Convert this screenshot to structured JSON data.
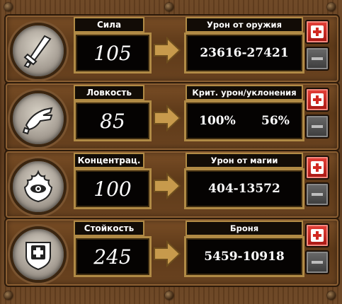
{
  "rows": [
    {
      "icon": "sword-icon",
      "stat_label": "Сила",
      "stat_value": "105",
      "result_label": "Урон от оружия",
      "result_value": "23616-27421",
      "plus_label": "+",
      "minus_label": "−"
    },
    {
      "icon": "dodge-hand-icon",
      "stat_label": "Ловкость",
      "stat_value": "85",
      "result_label": "Крит. урон/уклонения",
      "result_crit": "100%",
      "result_dodge": "56%",
      "plus_label": "+",
      "minus_label": "−"
    },
    {
      "icon": "fire-eye-icon",
      "stat_label": "Концентрац.",
      "stat_value": "100",
      "result_label": "Урон от магии",
      "result_value": "404-13572",
      "plus_label": "+",
      "minus_label": "−"
    },
    {
      "icon": "shield-icon",
      "stat_label": "Стойкость",
      "stat_value": "245",
      "result_label": "Броня",
      "result_value": "5459-10918",
      "plus_label": "+",
      "minus_label": "−"
    }
  ],
  "colors": {
    "plus_button": "#d22a22",
    "minus_button": "#555555",
    "frame": "#5e3a19",
    "label_border": "#b08a45"
  }
}
